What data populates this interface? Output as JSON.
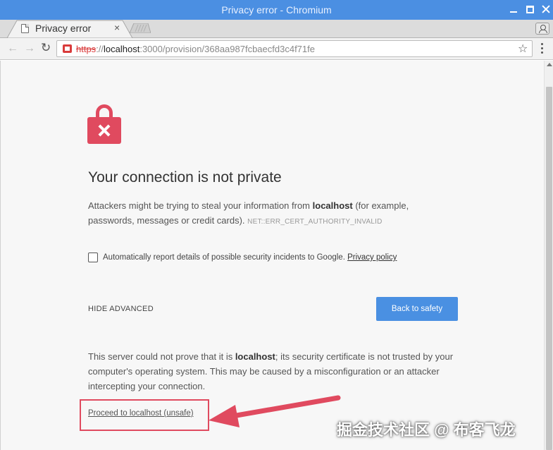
{
  "window": {
    "title": "Privacy error - Chromium"
  },
  "tab": {
    "label": "Privacy error",
    "close_glyph": "×"
  },
  "toolbar": {
    "back_glyph": "←",
    "forward_glyph": "→",
    "reload_glyph": "↻",
    "url_scheme": "https",
    "url_sep": "://",
    "url_host": "localhost",
    "url_rest": ":3000/provision/368aa987fcbaecfd3c4f71fe",
    "star_glyph": "☆"
  },
  "interstitial": {
    "heading": "Your connection is not private",
    "desc_part1": "Attackers might be trying to steal your information from ",
    "desc_host": "localhost",
    "desc_part2": " (for example, passwords, messages or credit cards).",
    "error_code": "NET::ERR_CERT_AUTHORITY_INVALID",
    "checkbox_label": "Automatically report details of possible security incidents to Google.",
    "privacy_link": "Privacy policy",
    "checkbox_checked": false,
    "hide_advanced": "HIDE ADVANCED",
    "back_to_safety": "Back to safety",
    "detail_part1": "This server could not prove that it is ",
    "detail_host": "localhost",
    "detail_part2": "; its security certificate is not trusted by your computer's operating system. This may be caused by a misconfiguration or an attacker intercepting your connection.",
    "proceed_link": "Proceed to localhost (unsafe)"
  },
  "overlay": {
    "watermark": "掘金技术社区 @ 布客飞龙",
    "annotation_color": "#e04a5f"
  },
  "colors": {
    "titlebar": "#4b8fe2",
    "accent_button": "#4a90e2",
    "lock": "#e04a5f"
  }
}
